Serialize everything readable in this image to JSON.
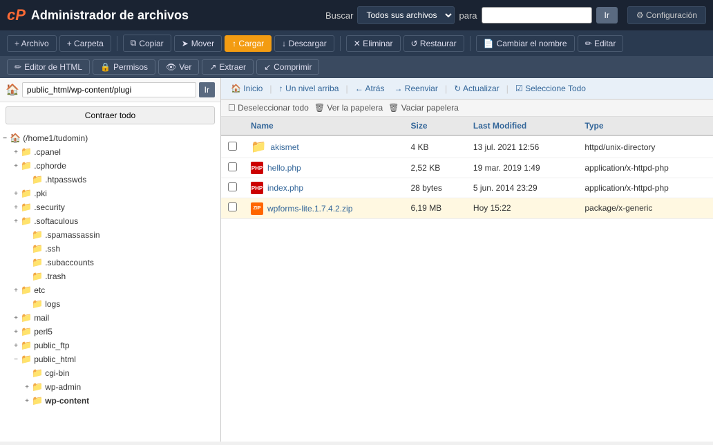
{
  "topbar": {
    "brand": "cP",
    "title": "Administrador de archivos",
    "search_label": "Buscar",
    "search_options": [
      "Todos sus archivos"
    ],
    "para_label": "para",
    "ir_label": "Ir",
    "config_label": "⚙ Configuración"
  },
  "toolbar": {
    "archivo": "+ Archivo",
    "carpeta": "+ Carpeta",
    "copiar": "Copiar",
    "mover": "Mover",
    "cargar": "↑ Cargar",
    "descargar": "↓ Descargar",
    "eliminar": "✕ Eliminar",
    "restaurar": "↺ Restaurar",
    "cambiar_nombre": "Cambiar el nombre",
    "editar": "✏ Editar"
  },
  "toolbar2": {
    "html_editor": "Editor de HTML",
    "permisos": "Permisos",
    "ver": "Ver",
    "extraer": "Extraer",
    "comprimir": "Comprimir"
  },
  "sidebar": {
    "path_value": "public_html/wp-content/plugi",
    "go_label": "Ir",
    "collapse_label": "Contraer todo",
    "tree": [
      {
        "id": "home",
        "label": "(/home1/tudomin)",
        "indent": 0,
        "toggle": "−",
        "is_root": true,
        "icon": "🏠"
      },
      {
        "id": "cpanel",
        "label": ".cpanel",
        "indent": 1,
        "toggle": "+",
        "has_children": true
      },
      {
        "id": "cphorde",
        "label": ".cphorde",
        "indent": 1,
        "toggle": "+",
        "has_children": true
      },
      {
        "id": "htpasswds",
        "label": ".htpasswds",
        "indent": 2,
        "toggle": "",
        "has_children": false
      },
      {
        "id": "pki",
        "label": ".pki",
        "indent": 1,
        "toggle": "+",
        "has_children": true
      },
      {
        "id": "security",
        "label": ".security",
        "indent": 1,
        "toggle": "+",
        "has_children": true
      },
      {
        "id": "softaculous",
        "label": ".softaculous",
        "indent": 1,
        "toggle": "+",
        "has_children": true
      },
      {
        "id": "spamassassin",
        "label": ".spamassassin",
        "indent": 2,
        "toggle": "",
        "has_children": false
      },
      {
        "id": "ssh",
        "label": ".ssh",
        "indent": 2,
        "toggle": "",
        "has_children": false
      },
      {
        "id": "subaccounts",
        "label": ".subaccounts",
        "indent": 2,
        "toggle": "",
        "has_children": false
      },
      {
        "id": "trash",
        "label": ".trash",
        "indent": 2,
        "toggle": "",
        "has_children": false
      },
      {
        "id": "etc",
        "label": "etc",
        "indent": 1,
        "toggle": "+",
        "has_children": true
      },
      {
        "id": "logs",
        "label": "logs",
        "indent": 2,
        "toggle": "",
        "has_children": false
      },
      {
        "id": "mail",
        "label": "mail",
        "indent": 1,
        "toggle": "+",
        "has_children": true
      },
      {
        "id": "perl5",
        "label": "perl5",
        "indent": 1,
        "toggle": "+",
        "has_children": true
      },
      {
        "id": "public_ftp",
        "label": "public_ftp",
        "indent": 1,
        "toggle": "+",
        "has_children": true
      },
      {
        "id": "public_html",
        "label": "public_html",
        "indent": 1,
        "toggle": "−",
        "has_children": true
      },
      {
        "id": "cgi_bin",
        "label": "cgi-bin",
        "indent": 2,
        "toggle": "",
        "has_children": false
      },
      {
        "id": "wp_admin",
        "label": "wp-admin",
        "indent": 2,
        "toggle": "+",
        "has_children": true
      },
      {
        "id": "wp_content",
        "label": "wp-content",
        "indent": 2,
        "toggle": "+",
        "has_children": true,
        "bold": true
      }
    ]
  },
  "action_bar": {
    "inicio": "🏠 Inicio",
    "un_nivel": "↑ Un nivel arriba",
    "atras": "← Atrás",
    "reenviar": "→ Reenviar",
    "actualizar": "↻ Actualizar",
    "seleccione_todo": "☑ Seleccione Todo"
  },
  "sub_action_bar": {
    "deseleccionar": "☐ Deseleccionar todo",
    "ver_papelera": "🗑 Ver la papelera",
    "vaciar_papelera": "🗑 Vaciar papelera"
  },
  "file_table": {
    "headers": [
      "Name",
      "Size",
      "Last Modified",
      "Type"
    ],
    "rows": [
      {
        "icon_type": "folder",
        "name": "akismet",
        "size": "4 KB",
        "modified": "13 jul. 2021 12:56",
        "type": "httpd/unix-directory"
      },
      {
        "icon_type": "php",
        "name": "hello.php",
        "size": "2,52 KB",
        "modified": "19 mar. 2019 1:49",
        "type": "application/x-httpd-php"
      },
      {
        "icon_type": "php",
        "name": "index.php",
        "size": "28 bytes",
        "modified": "5 jun. 2014 23:29",
        "type": "application/x-httpd-php"
      },
      {
        "icon_type": "zip",
        "name": "wpforms-lite.1.7.4.2.zip",
        "size": "6,19 MB",
        "modified": "Hoy 15:22",
        "type": "package/x-generic",
        "highlight": true
      }
    ]
  }
}
